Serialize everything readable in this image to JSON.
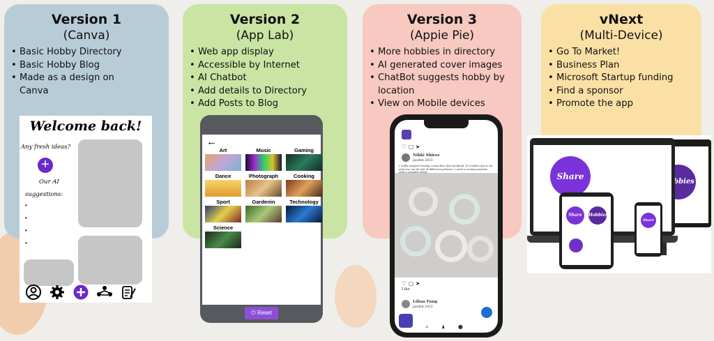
{
  "cards": [
    {
      "title": "Version 1",
      "subtitle": "(Canva)",
      "items": [
        "Basic Hobby Directory",
        "Basic Hobby Blog",
        "Made as a design on Canva"
      ]
    },
    {
      "title": "Version 2",
      "subtitle": "(App Lab)",
      "items": [
        "Web app display",
        "Accessible by Internet",
        "AI Chatbot",
        "Add details to Directory",
        "Add Posts to Blog"
      ]
    },
    {
      "title": "Version 3",
      "subtitle": "(Appie Pie)",
      "items": [
        "More hobbies in directory",
        "AI generated cover images",
        "ChatBot suggests hobby by location",
        "View on Mobile devices"
      ]
    },
    {
      "title": "vNext",
      "subtitle": "(Multi-Device)",
      "items": [
        "Go To Market!",
        "Business Plan",
        "Microsoft Startup funding",
        "Find a sponsor",
        "Promote the app"
      ]
    }
  ],
  "v1_mockup": {
    "title": "Welcome back!",
    "fresh_ideas": "Any fresh ideas?",
    "plus": "+",
    "our_ai": "Our AI",
    "suggestions": "suggestions:"
  },
  "v2_mockup": {
    "back": "←",
    "categories": [
      "Art",
      "Music",
      "Gaming",
      "Dance",
      "Photograph",
      "Cooking",
      "Sport",
      "Gardenin",
      "Technology",
      "Science"
    ],
    "reset": "Reset"
  },
  "v3_mockup": {
    "author": "Nikki Shires",
    "date": "jan/feb 2023",
    "post_text": "I really enjoyed sewing scrunchies this weekend. It's really easy to do and you can do lots of different patterns. I used a sewing machine with a straight stitch.",
    "like": "Like",
    "author2": "Lilian Fung",
    "date2": "jan/feb 2023"
  },
  "vnext_mockup": {
    "share": "Share",
    "hobbies": "Hobbies"
  }
}
